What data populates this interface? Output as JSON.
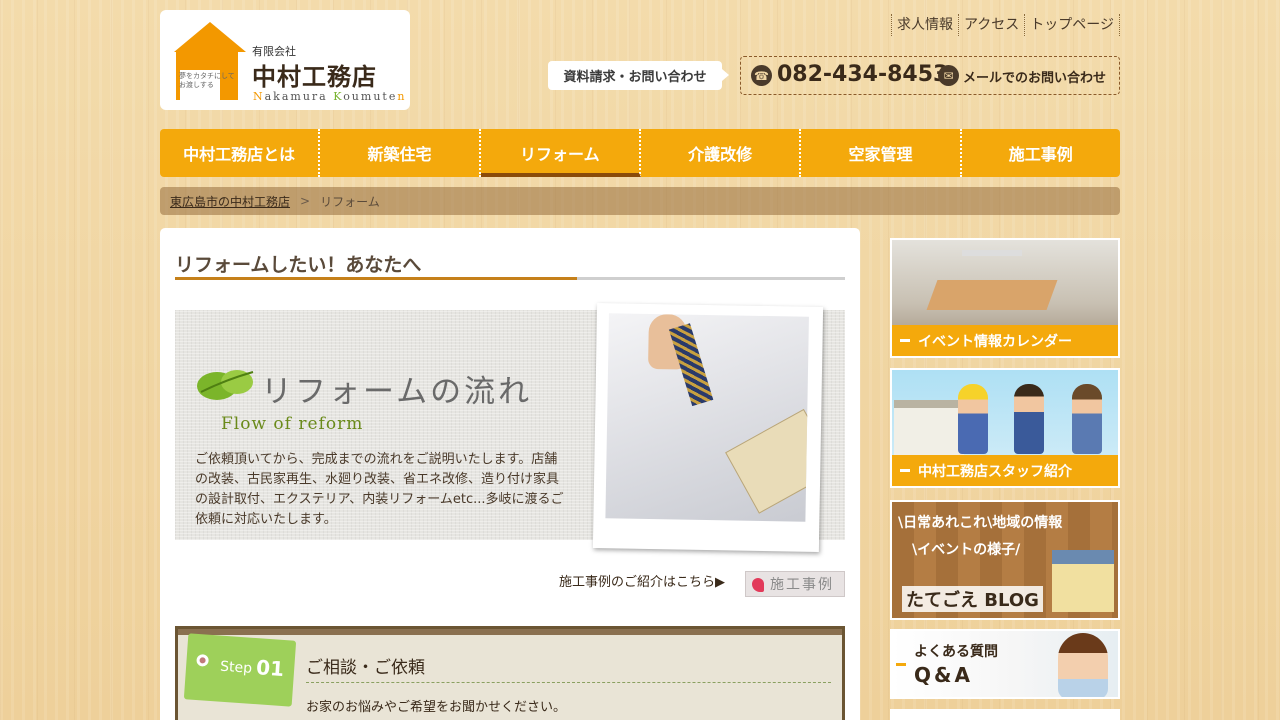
{
  "header": {
    "logo": {
      "company_type": "有限会社",
      "name": "中村工務店",
      "romanized": [
        "N",
        "akamura ",
        "K",
        "oumute",
        "n"
      ],
      "tagline": "夢をカタチにしてお渡しする"
    },
    "utility_links": [
      "求人情報",
      "アクセス",
      "トップページ"
    ],
    "request_button": "資料請求・お問い合わせ",
    "phone": "082-434-8453",
    "mail_link": "メールでのお問い合わせ"
  },
  "nav": {
    "items": [
      "中村工務店とは",
      "新築住宅",
      "リフォーム",
      "介護改修",
      "空家管理",
      "施工事例"
    ],
    "active": "リフォーム"
  },
  "breadcrumb": {
    "home": "東広島市の中村工務店",
    "separator": ">",
    "current": "リフォーム"
  },
  "main": {
    "title": "リフォームしたい！あなたへ",
    "hero": {
      "title": "リフォームの流れ",
      "subtitle": "Flow of reform",
      "description": "ご依頼頂いてから、完成までの流れをご説明いたします。店舗の改装、古民家再生、水廻り改装、省エネ改修、造り付け家具の設計取付、エクステリア、内装リフォームetc...多岐に渡るご依頼に対応いたします。"
    },
    "case_link_text": "施工事例のご紹介はこちら▶",
    "case_button": "施工事例",
    "step": {
      "word": "Step",
      "number": "01",
      "title": "ご相談・ご依頼",
      "text": "お家のお悩みやご希望をお聞かせください。"
    }
  },
  "sidebar": {
    "banners": [
      {
        "label": "イベント情報カレンダー"
      },
      {
        "label": "中村工務店スタッフ紹介"
      },
      {
        "line1": "\\日常あれこれ\\地域の情報",
        "line2": "\\イベントの様子/",
        "title": "たてごえ BLOG"
      },
      {
        "line1": "よくある質問",
        "line2": "Q&A"
      }
    ]
  },
  "colors": {
    "accent": "#f4a90c",
    "nav_active_underline": "#8a4b0a",
    "title_underline": "#c5801a",
    "step_tag": "#9ed05a"
  },
  "icons": {
    "phone": "phone-icon",
    "mail": "mail-icon",
    "leaf": "leaf-icon",
    "house": "house-logo-icon",
    "shoe": "shoe-icon"
  }
}
